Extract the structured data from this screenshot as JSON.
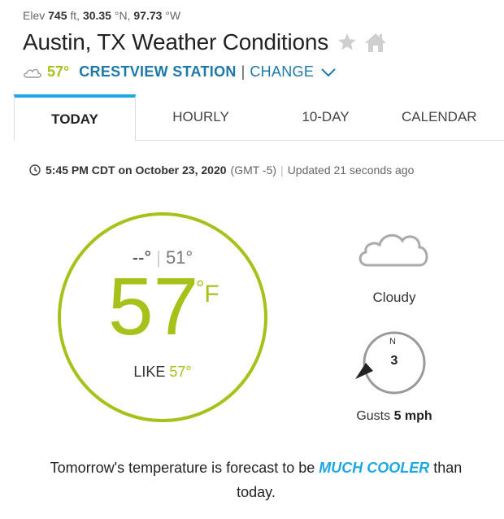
{
  "location": {
    "elev_label": "Elev",
    "elevation": "745",
    "elev_unit": "ft,",
    "lat": "30.35",
    "lat_unit": "°N,",
    "lon": "97.73",
    "lon_unit": "°W",
    "title": "Austin, TX Weather Conditions"
  },
  "station": {
    "temp": "57°",
    "name": "CRESTVIEW STATION",
    "separator": "|",
    "change_label": "CHANGE"
  },
  "tabs": [
    {
      "label": "TODAY",
      "active": true
    },
    {
      "label": "HOURLY",
      "active": false
    },
    {
      "label": "10-DAY",
      "active": false
    },
    {
      "label": "CALENDAR",
      "active": false
    }
  ],
  "timestamp": {
    "time": "5:45 PM CDT on October 23, 2020",
    "gmt": "(GMT -5)",
    "separator": "|",
    "updated": "Updated 21 seconds ago"
  },
  "current": {
    "high": "--°",
    "pipe": "|",
    "low": "51°",
    "temp": "57",
    "deg": "°",
    "unit": "F",
    "feels_label": "LIKE",
    "feels_value": "57°",
    "condition": "Cloudy",
    "condition_icon": "cloud-icon",
    "wind_dir_label": "N",
    "wind_speed": "3",
    "gusts_label": "Gusts",
    "gusts_value": "5 mph"
  },
  "forecast": {
    "prefix": "Tomorrow's temperature is forecast to be",
    "highlight": "MUCH COOLER",
    "suffix": "than today."
  },
  "colors": {
    "accent_green": "#a6c21a",
    "link_blue": "#1e78a8",
    "tab_blue": "#1ea7e0",
    "highlight_blue": "#1ea7e0"
  }
}
